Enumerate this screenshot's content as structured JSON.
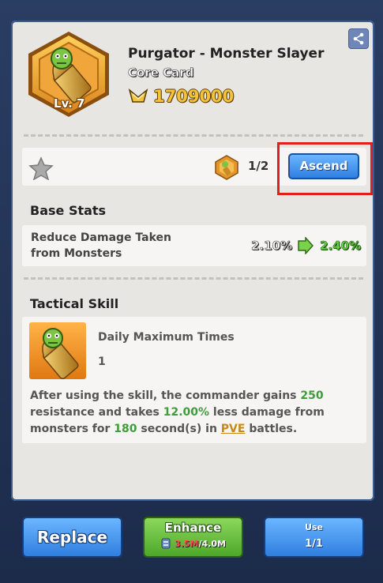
{
  "card": {
    "name": "Purgator - Monster Slayer",
    "type": "Core Card",
    "level": "Lv. 7",
    "power": "1709000"
  },
  "ascend": {
    "count": "1/2",
    "button": "Ascend"
  },
  "base_stats": {
    "title": "Base Stats",
    "label": "Reduce Damage Taken from Monsters",
    "current": "2.10%",
    "next": "2.40%"
  },
  "tactical_skill": {
    "title": "Tactical Skill",
    "name": "Daily Maximum Times",
    "value": "1",
    "desc": {
      "p1": "After using the skill, the commander gains ",
      "resist": "250",
      "p2": " resistance and takes ",
      "reduce": "12.00%",
      "p3": " less damage from monsters for ",
      "dur": "180",
      "p4": " second(s) in ",
      "mode": "PVE",
      "p5": " battles."
    }
  },
  "buttons": {
    "replace": "Replace",
    "enhance": "Enhance",
    "enhance_have": "3.5M",
    "enhance_need": "/4.0M",
    "use": "Use",
    "use_count": "1/1"
  },
  "colors": {
    "accent_blue": "#2f7fe0",
    "accent_green": "#4ea82a",
    "gold": "#f5c33b",
    "highlight": "#e0201c"
  }
}
